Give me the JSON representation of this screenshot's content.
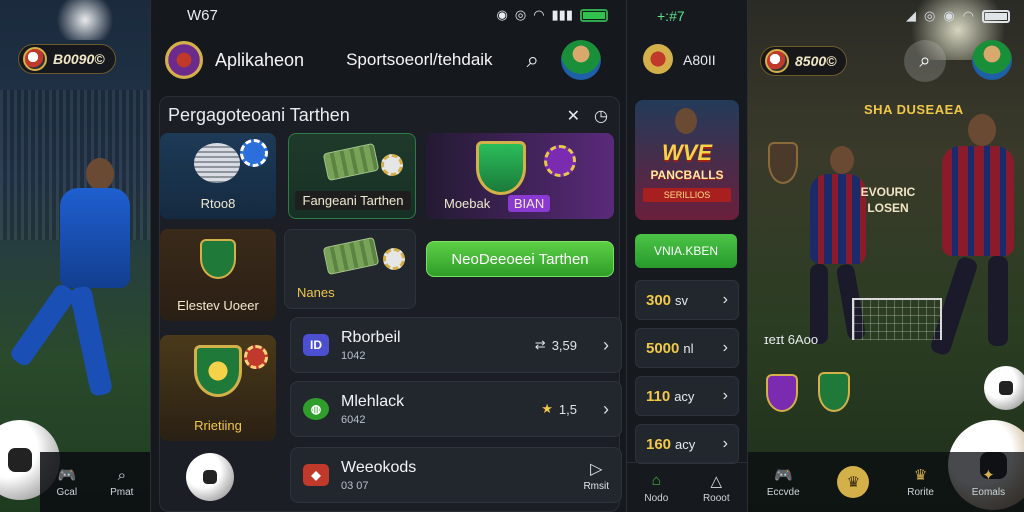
{
  "left_panel": {
    "balance": "B0090©",
    "nav": [
      {
        "label": "Gcal",
        "icon": "gamepad-icon"
      },
      {
        "label": "Pmat",
        "icon": "search-icon"
      }
    ]
  },
  "main": {
    "status_time": "W67",
    "app_title": "Aplikaheon",
    "tab_title": "Sportsoeorl/tehdaik",
    "section_title": "Pergagoteoani Tarthen",
    "cards": [
      {
        "label": "Rtoo8"
      },
      {
        "label": "Fangeani Tarthen"
      },
      {
        "label": "Moebak",
        "extra": "BIAN"
      },
      {
        "label": "Elestev Uoeer"
      },
      {
        "label": "Nanes"
      },
      {
        "label": "Rrietiing"
      }
    ],
    "cta_button": "NeoDeeoeei Tarthen",
    "rows": [
      {
        "name": "Rborbeil",
        "sub": "1042",
        "meta": "3,59",
        "icon_text": "ID",
        "icon": "ticket-icon"
      },
      {
        "name": "Mlehlack",
        "sub": "6042",
        "meta": "1,5",
        "icon_text": "",
        "icon": "star-icon"
      },
      {
        "name": "Weeokods",
        "sub": "03 07",
        "meta": "Rmsit",
        "icon_text": "",
        "icon": "play-icon"
      }
    ]
  },
  "side": {
    "time": "+:#7",
    "title": "A80II",
    "promo_title": "WVE",
    "promo_sub": "PANCBALLS",
    "promo_banner": "SERILLIOS",
    "button": "VNIA.KBEN",
    "odds": [
      {
        "value": "300",
        "unit": "sv"
      },
      {
        "value": "5000",
        "unit": "nl"
      },
      {
        "value": "110",
        "unit": "acy"
      },
      {
        "value": "160",
        "unit": "acy"
      }
    ],
    "nav": [
      {
        "label": "Nodo",
        "icon": "home-icon"
      },
      {
        "label": "Rooot",
        "icon": "bell-icon"
      }
    ]
  },
  "right_panel": {
    "balance": "8500©",
    "title": "SHA DUSEAEA",
    "card_text": "EVOURIC LOSEN",
    "meta": "ɪeɪt 6Aoo",
    "nav": [
      {
        "label": "Eccvde",
        "icon": "controller-icon"
      },
      {
        "label": "",
        "icon": "trophy-icon"
      },
      {
        "label": "Rorite",
        "icon": "trophy-icon"
      },
      {
        "label": "Eomals",
        "icon": "star-icon"
      }
    ]
  },
  "colors": {
    "accent_green": "#3fb83a",
    "gold": "#d4b04a",
    "bg": "#15181d"
  }
}
